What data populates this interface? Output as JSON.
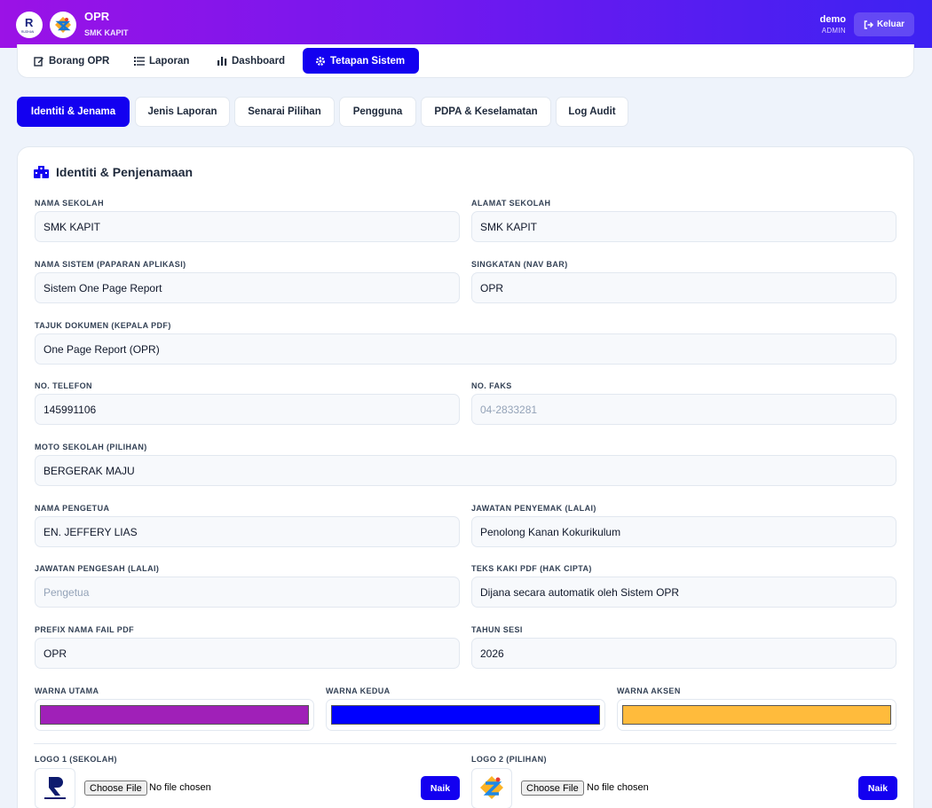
{
  "header": {
    "title": "OPR",
    "subtitle": "SMK KAPIT",
    "user_name": "demo",
    "user_role": "ADMIN",
    "logout_label": "Keluar",
    "logo1_text": "R",
    "logo1_sub": "RUZIHAN"
  },
  "nav": [
    {
      "label": "Borang OPR",
      "icon": "edit-icon"
    },
    {
      "label": "Laporan",
      "icon": "list-icon"
    },
    {
      "label": "Dashboard",
      "icon": "bar-chart-icon"
    },
    {
      "label": "Tetapan Sistem",
      "icon": "gear-icon",
      "active": true
    }
  ],
  "subtabs": [
    {
      "label": "Identiti & Jenama",
      "active": true
    },
    {
      "label": "Jenis Laporan"
    },
    {
      "label": "Senarai Pilihan"
    },
    {
      "label": "Pengguna"
    },
    {
      "label": "PDPA & Keselamatan"
    },
    {
      "label": "Log Audit"
    }
  ],
  "section": {
    "title": "Identiti & Penjenamaan",
    "icon": "building-icon"
  },
  "fields": {
    "nama_sekolah": {
      "label": "NAMA SEKOLAH",
      "value": "SMK KAPIT",
      "placeholder": ""
    },
    "alamat_sekolah": {
      "label": "ALAMAT SEKOLAH",
      "value": "SMK KAPIT",
      "placeholder": ""
    },
    "nama_sistem": {
      "label": "NAMA SISTEM (PAPARAN APLIKASI)",
      "value": "Sistem One Page Report",
      "placeholder": ""
    },
    "singkatan": {
      "label": "SINGKATAN (NAV BAR)",
      "value": "OPR",
      "placeholder": ""
    },
    "tajuk_dokumen": {
      "label": "TAJUK DOKUMEN (KEPALA PDF)",
      "value": "One Page Report (OPR)",
      "placeholder": ""
    },
    "no_telefon": {
      "label": "NO. TELEFON",
      "value": "145991106",
      "placeholder": ""
    },
    "no_faks": {
      "label": "NO. FAKS",
      "value": "",
      "placeholder": "04-2833281"
    },
    "moto": {
      "label": "MOTO SEKOLAH (PILIHAN)",
      "value": "BERGERAK MAJU",
      "placeholder": ""
    },
    "nama_pengetua": {
      "label": "NAMA PENGETUA",
      "value": "EN. JEFFERY LIAS",
      "placeholder": ""
    },
    "jawatan_penyemak": {
      "label": "JAWATAN PENYEMAK (LALAI)",
      "value": "Penolong Kanan Kokurikulum",
      "placeholder": ""
    },
    "jawatan_pengesah": {
      "label": "JAWATAN PENGESAH (LALAI)",
      "value": "",
      "placeholder": "Pengetua"
    },
    "teks_kaki": {
      "label": "TEKS KAKI PDF (HAK CIPTA)",
      "value": "Dijana secara automatik oleh Sistem OPR",
      "placeholder": ""
    },
    "prefix": {
      "label": "PREFIX NAMA FAIL PDF",
      "value": "OPR",
      "placeholder": ""
    },
    "tahun_sesi": {
      "label": "TAHUN SESI",
      "value": "2026",
      "placeholder": ""
    }
  },
  "colors": {
    "utama": {
      "label": "WARNA UTAMA",
      "value": "#a020b8"
    },
    "kedua": {
      "label": "WARNA KEDUA",
      "value": "#0000ff"
    },
    "aksen": {
      "label": "WARNA AKSEN",
      "value": "#ffbb3c"
    }
  },
  "logos": {
    "logo1": {
      "label": "LOGO 1 (SEKOLAH)",
      "button": "Choose File",
      "status": "No file chosen",
      "upload": "Naik"
    },
    "logo2": {
      "label": "LOGO 2 (PILIHAN)",
      "button": "Choose File",
      "status": "No file chosen",
      "upload": "Naik"
    }
  }
}
